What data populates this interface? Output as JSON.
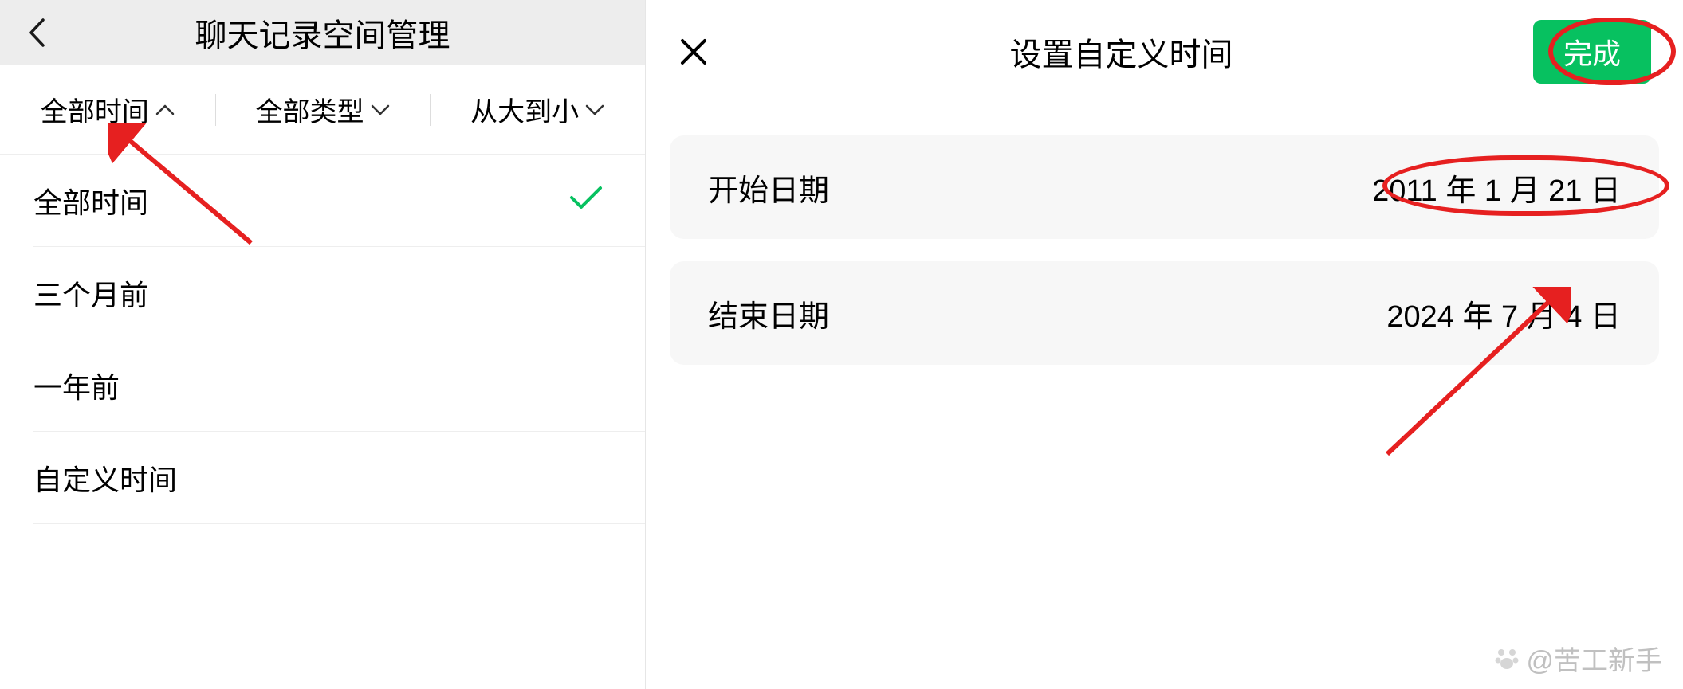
{
  "left": {
    "title": "聊天记录空间管理",
    "filters": {
      "time": "全部时间",
      "type": "全部类型",
      "sort": "从大到小"
    },
    "options": [
      "全部时间",
      "三个月前",
      "一年前",
      "自定义时间"
    ]
  },
  "right": {
    "title": "设置自定义时间",
    "done": "完成",
    "start_label": "开始日期",
    "start_value": "2011 年 1 月 21 日",
    "end_label": "结束日期",
    "end_value": "2024 年 7 月 4 日"
  },
  "watermark": "@苦工新手",
  "colors": {
    "accent": "#07c160",
    "annotation": "#e62020"
  }
}
